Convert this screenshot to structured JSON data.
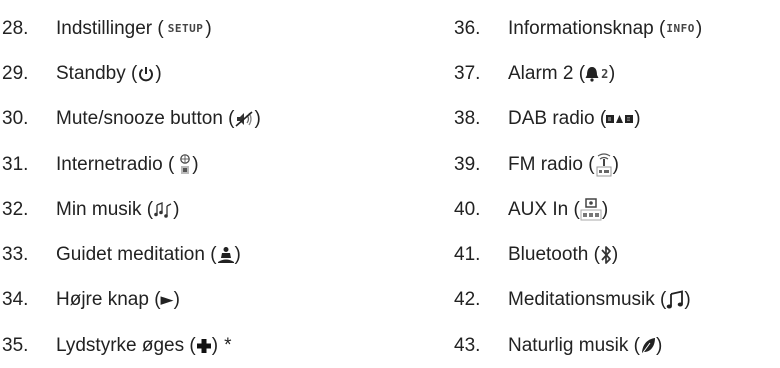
{
  "left_column": [
    {
      "number": "28.",
      "label": "Indstillinger (",
      "icon_text": "SETUP",
      "close": ")",
      "icon": "setup-text-icon"
    },
    {
      "number": "29.",
      "label": "Standby  (",
      "close": ")",
      "icon": "power-icon"
    },
    {
      "number": "30.",
      "label": "Mute/snooze button (",
      "close": " )",
      "icon": "mute-speaker-icon"
    },
    {
      "number": "31.",
      "label": "Internetradio (",
      "close": " )",
      "icon": "internet-radio-icon"
    },
    {
      "number": "32.",
      "label": "Min musik (",
      "close": ")",
      "icon": "music-notes-icon"
    },
    {
      "number": "33.",
      "label": "Guidet meditation (",
      "close": ")",
      "icon": "meditation-figure-icon"
    },
    {
      "number": "34.",
      "label": "Højre knap (",
      "icon_text": "►",
      "close": ")",
      "icon": "right-arrow-icon"
    },
    {
      "number": "35.",
      "label": "Lydstyrke øges (",
      "close": ")",
      "icon": "plus-icon",
      "note": "*"
    }
  ],
  "right_column": [
    {
      "number": "36.",
      "label": "Informationsknap (",
      "icon_text": "INFO",
      "close": ")",
      "icon": "info-text-icon"
    },
    {
      "number": "37.",
      "label": "Alarm 2 (",
      "icon_text": "2",
      "close": " )",
      "icon": "alarm-bell-icon"
    },
    {
      "number": "38.",
      "label": "DAB radio (",
      "close": ")",
      "icon": "dab-icon"
    },
    {
      "number": "39.",
      "label": "FM radio (",
      "close": ")",
      "icon": "fm-radio-icon"
    },
    {
      "number": "40.",
      "label": "AUX In (",
      "close": ")",
      "icon": "aux-in-icon"
    },
    {
      "number": "41.",
      "label": "Bluetooth (",
      "close": ")",
      "icon": "bluetooth-icon"
    },
    {
      "number": "42.",
      "label": "Meditationsmusik  (",
      "close": ")",
      "icon": "music-note-icon"
    },
    {
      "number": "43.",
      "label": "Naturlig musik  (",
      "close": ")",
      "icon": "leaf-icon"
    }
  ]
}
